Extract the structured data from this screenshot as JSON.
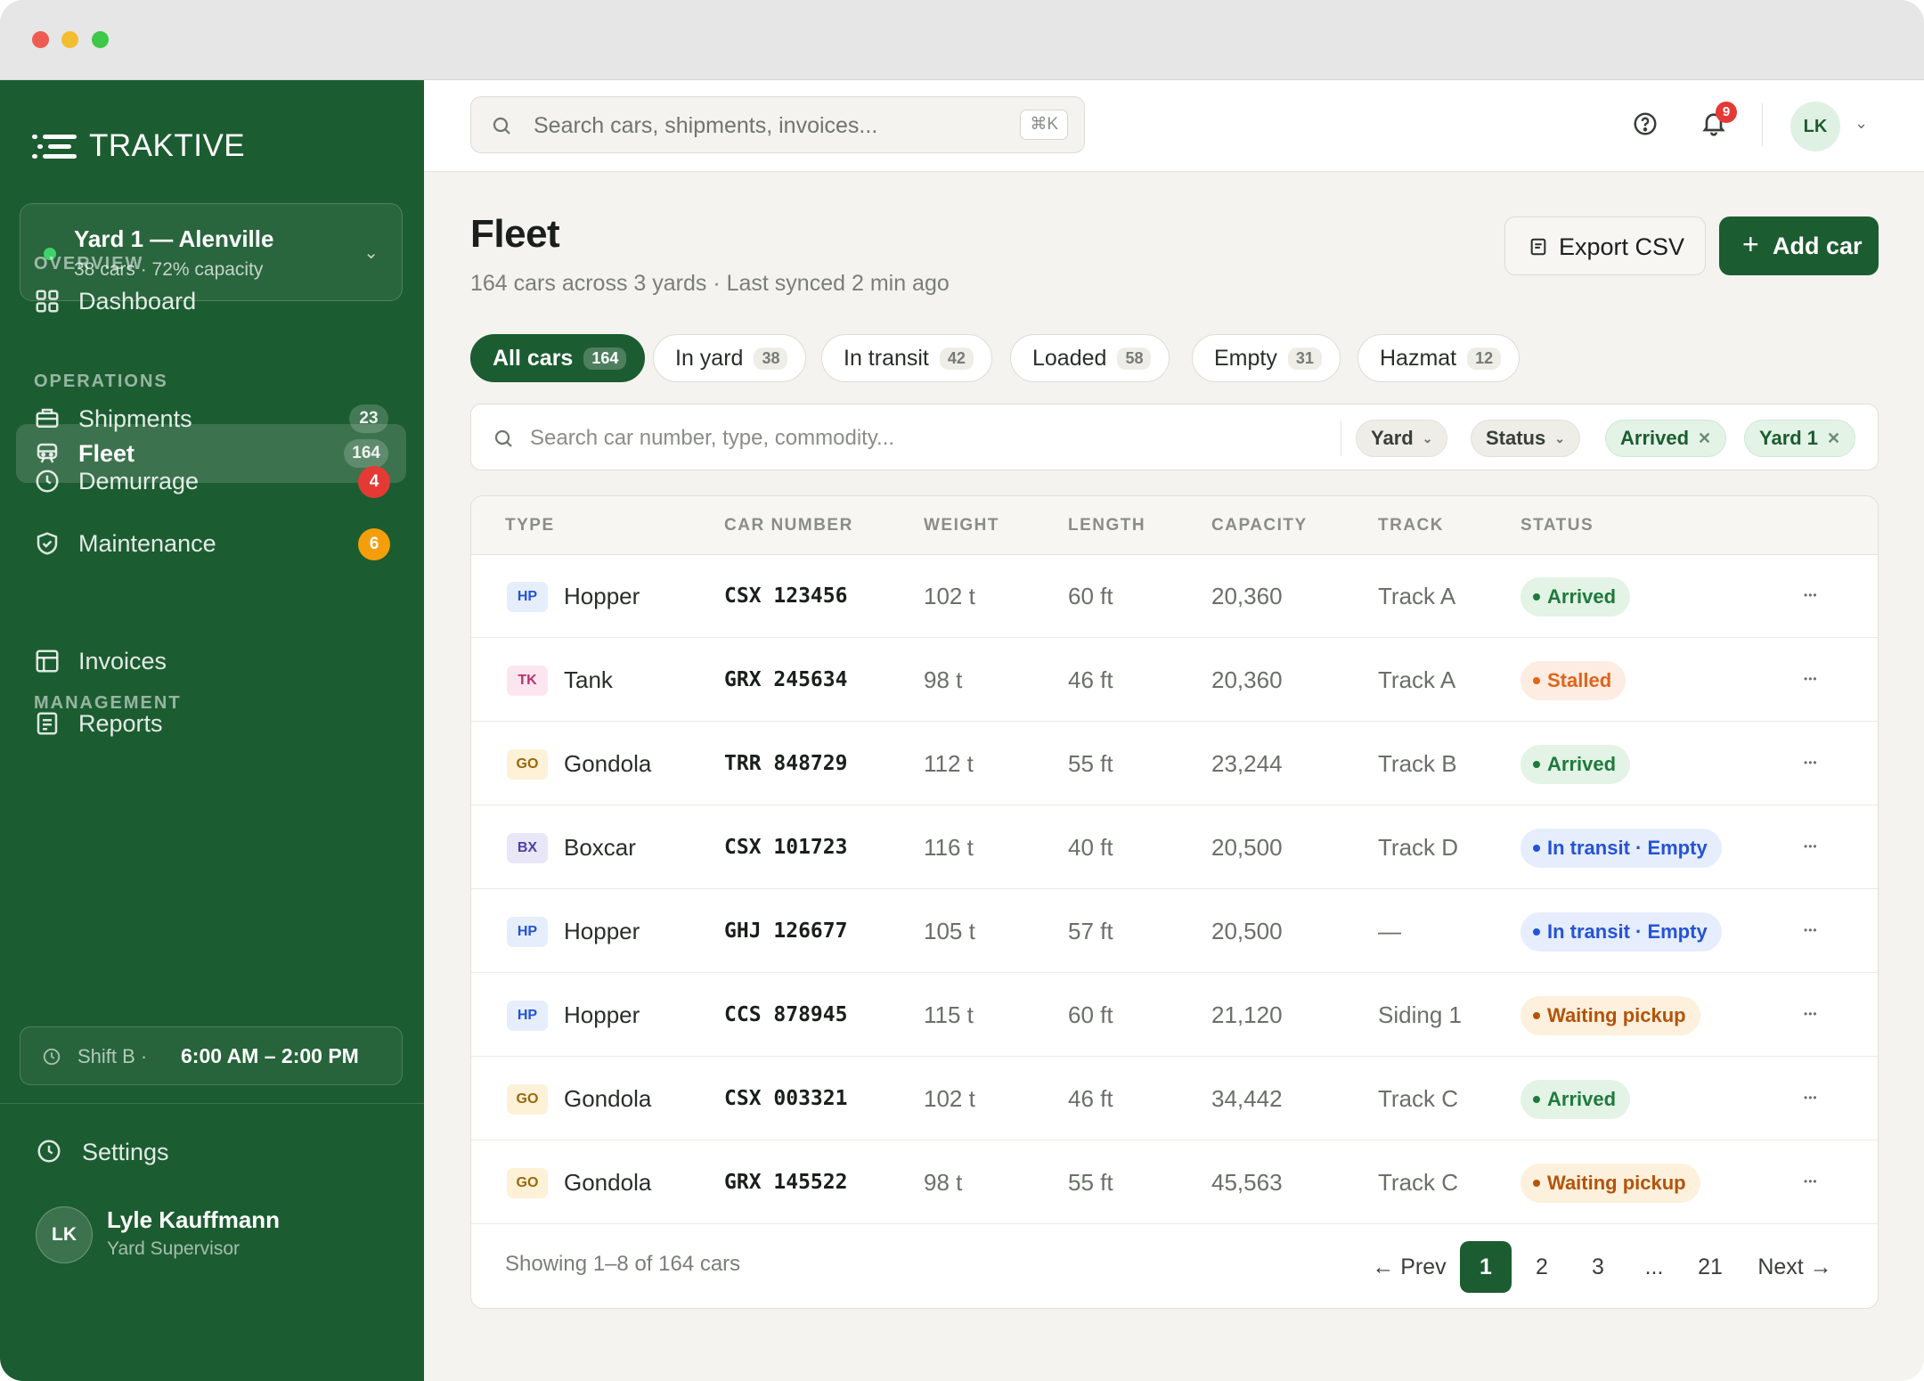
{
  "brand": {
    "name": "TRAKTIVE"
  },
  "yard_switcher": {
    "name": "Yard 1 — Alenville",
    "sub": "38 cars · 72% capacity"
  },
  "sidebar": {
    "sections": {
      "overview": "OVERVIEW",
      "operations": "OPERATIONS",
      "management": "MANAGEMENT"
    },
    "items": [
      {
        "label": "Dashboard",
        "icon": "grid-icon"
      },
      {
        "label": "Fleet",
        "icon": "train-icon",
        "count": "164",
        "active": true
      },
      {
        "label": "Shipments",
        "icon": "package-icon",
        "count": "23"
      },
      {
        "label": "Demurrage",
        "icon": "clock-icon",
        "badge": "4",
        "badge_color": "#e53935"
      },
      {
        "label": "Maintenance",
        "icon": "shield-icon",
        "badge": "6",
        "badge_color": "#f59e0b"
      },
      {
        "label": "Invoices",
        "icon": "layout-icon"
      },
      {
        "label": "Reports",
        "icon": "document-icon"
      }
    ],
    "shift": {
      "label": "Shift B ·",
      "time": "6:00 AM – 2:00 PM"
    },
    "settings_label": "Settings",
    "user": {
      "initials": "LK",
      "name": "Lyle Kauffmann",
      "role": "Yard Supervisor"
    }
  },
  "topbar": {
    "search_placeholder": "Search cars, shipments, invoices...",
    "shortcut": "⌘K",
    "notifications_count": "9",
    "avatar_initials": "LK"
  },
  "page": {
    "title": "Fleet",
    "subtitle": "164 cars across 3 yards · Last synced 2 min ago",
    "export_label": "Export CSV",
    "add_label": "Add car"
  },
  "tabs": [
    {
      "label": "All cars",
      "count": "164",
      "active": true
    },
    {
      "label": "In yard",
      "count": "38"
    },
    {
      "label": "In transit",
      "count": "42"
    },
    {
      "label": "Loaded",
      "count": "58"
    },
    {
      "label": "Empty",
      "count": "31"
    },
    {
      "label": "Hazmat",
      "count": "12"
    }
  ],
  "filters": {
    "search_placeholder": "Search car number, type, commodity...",
    "dropdowns": [
      "Yard",
      "Status"
    ],
    "active": [
      "Arrived",
      "Yard 1"
    ]
  },
  "table": {
    "columns": [
      "TYPE",
      "CAR NUMBER",
      "WEIGHT",
      "LENGTH",
      "CAPACITY",
      "TRACK",
      "STATUS"
    ],
    "rows": [
      {
        "code": "HP",
        "type": "Hopper",
        "car": "CSX 123456",
        "weight": "102 t",
        "length": "60 ft",
        "capacity": "20,360",
        "track": "Track A",
        "status": "Arrived"
      },
      {
        "code": "TK",
        "type": "Tank",
        "car": "GRX 245634",
        "weight": "98 t",
        "length": "46 ft",
        "capacity": "20,360",
        "track": "Track A",
        "status": "Stalled"
      },
      {
        "code": "GO",
        "type": "Gondola",
        "car": "TRR 848729",
        "weight": "112 t",
        "length": "55 ft",
        "capacity": "23,244",
        "track": "Track B",
        "status": "Arrived"
      },
      {
        "code": "BX",
        "type": "Boxcar",
        "car": "CSX 101723",
        "weight": "116 t",
        "length": "40 ft",
        "capacity": "20,500",
        "track": "Track D",
        "status": "In transit · Empty"
      },
      {
        "code": "HP",
        "type": "Hopper",
        "car": "GHJ 126677",
        "weight": "105 t",
        "length": "57 ft",
        "capacity": "20,500",
        "track": "—",
        "status": "In transit · Empty"
      },
      {
        "code": "HP",
        "type": "Hopper",
        "car": "CCS 878945",
        "weight": "115 t",
        "length": "60 ft",
        "capacity": "21,120",
        "track": "Siding 1",
        "status": "Waiting pickup"
      },
      {
        "code": "GO",
        "type": "Gondola",
        "car": "CSX 003321",
        "weight": "102 t",
        "length": "46 ft",
        "capacity": "34,442",
        "track": "Track C",
        "status": "Arrived"
      },
      {
        "code": "GO",
        "type": "Gondola",
        "car": "GRX 145522",
        "weight": "98 t",
        "length": "55 ft",
        "capacity": "45,563",
        "track": "Track C",
        "status": "Waiting pickup"
      }
    ],
    "footer": "Showing 1–8 of 164 cars"
  },
  "pagination": {
    "prev": "← Prev",
    "pages": [
      "1",
      "2",
      "3",
      "...",
      "21"
    ],
    "next": "Next →",
    "current": "1"
  },
  "colors": {
    "brand_green": "#1c5c31",
    "status_arrived": "#1e7a3c",
    "status_stalled": "#e0641b",
    "status_transit": "#2453d6",
    "status_waiting": "#b45309"
  }
}
